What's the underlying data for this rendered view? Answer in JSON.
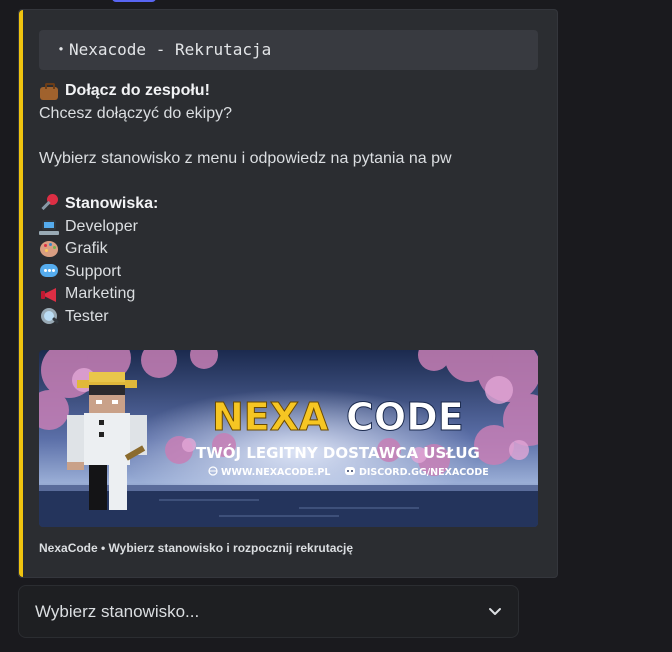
{
  "embed": {
    "accent_color": "#f0c40f",
    "code_title": "・Nexacode - Rekrutacja",
    "heading": "Dołącz do zespołu!",
    "intro": "Chcesz dołączyć do ekipy?",
    "instruction": "Wybierz stanowisko z menu i odpowiedz na pytania na pw",
    "positions_heading": "Stanowiska:",
    "positions": [
      {
        "icon": "laptop-icon",
        "label": "Developer"
      },
      {
        "icon": "palette-icon",
        "label": "Grafik"
      },
      {
        "icon": "speech-bubble-icon",
        "label": "Support"
      },
      {
        "icon": "megaphone-icon",
        "label": "Marketing"
      },
      {
        "icon": "magnifier-icon",
        "label": "Tester"
      }
    ],
    "banner": {
      "title_part1": "NEXA",
      "title_part2": "CODE",
      "subtitle": "TWÓJ LEGITNY DOSTAWCA USŁUG",
      "website": "WWW.NEXACODE.PL",
      "discord": "DISCORD.GG/NEXACODE"
    },
    "footer": "NexaCode • Wybierz stanowisko i rozpocznij rekrutację"
  },
  "select_menu": {
    "placeholder": "Wybierz stanowisko..."
  }
}
